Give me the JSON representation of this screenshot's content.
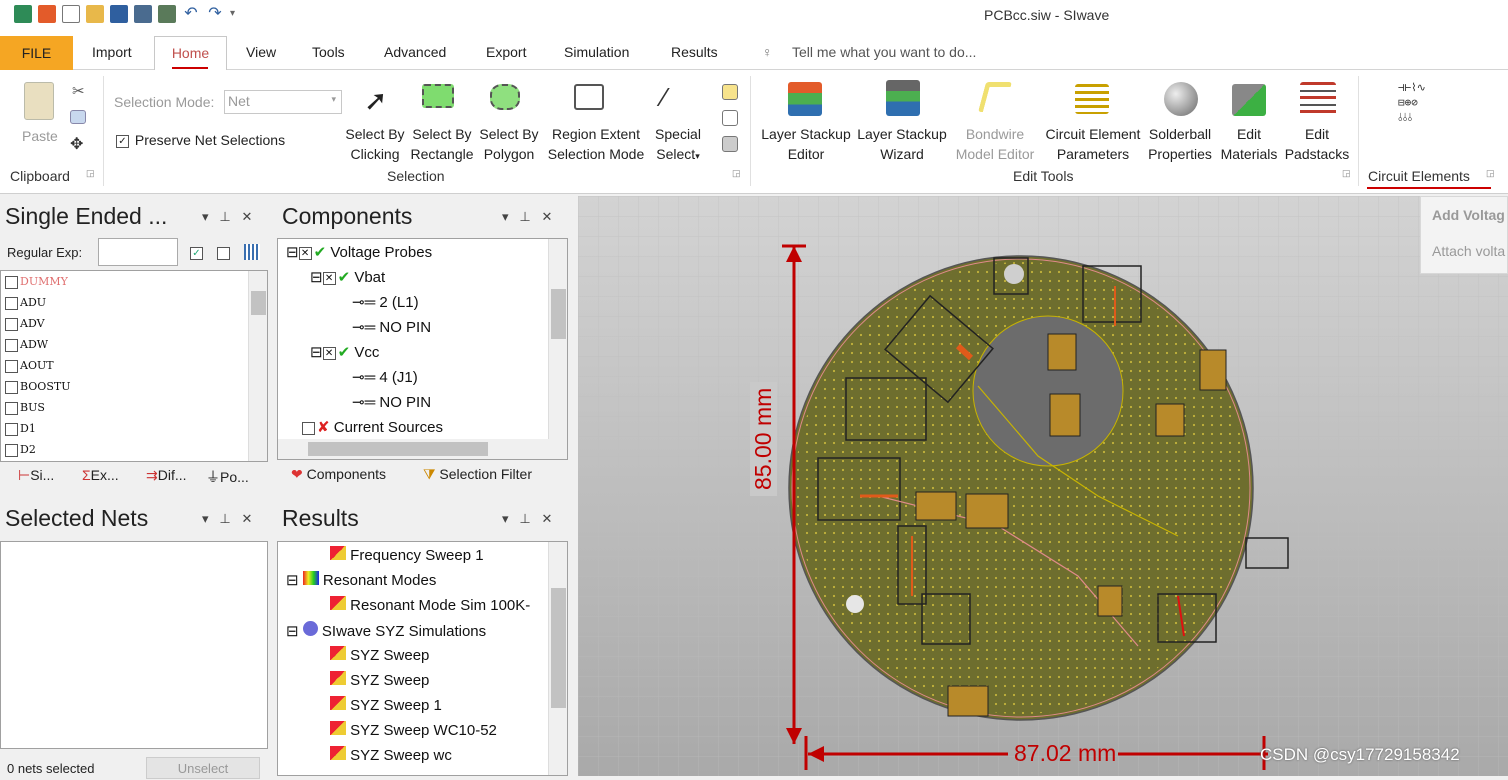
{
  "window": {
    "title": "PCBcc.siw - SIwave"
  },
  "menu": {
    "tabs": [
      "FILE",
      "Import",
      "Home",
      "View",
      "Tools",
      "Advanced",
      "Export",
      "Simulation",
      "Results"
    ],
    "tell_me": "Tell me what you want to do..."
  },
  "ribbon": {
    "clipboard": {
      "paste": "Paste",
      "group": "Clipboard"
    },
    "selection": {
      "mode_label": "Selection Mode:",
      "mode_value": "Net",
      "preserve_label": "Preserve Net Selections",
      "buttons": [
        [
          "Select By",
          "Clicking"
        ],
        [
          "Select By",
          "Rectangle"
        ],
        [
          "Select By",
          "Polygon"
        ],
        [
          "Region Extent",
          "Selection Mode"
        ],
        [
          "Special",
          "Select"
        ]
      ],
      "group": "Selection"
    },
    "edit_tools": {
      "buttons": [
        [
          "Layer Stackup",
          "Editor"
        ],
        [
          "Layer Stackup",
          "Wizard"
        ],
        [
          "Bondwire",
          "Model Editor"
        ],
        [
          "Circuit Element",
          "Parameters"
        ],
        [
          "Solderball",
          "Properties"
        ],
        [
          "Edit",
          "Materials"
        ],
        [
          "Edit",
          "Padstacks"
        ]
      ],
      "group": "Edit Tools"
    },
    "circuit": {
      "group": "Circuit Elements"
    }
  },
  "popup": {
    "items": [
      "Add Voltag",
      "Attach volta"
    ]
  },
  "nets_panel": {
    "title": "Single Ended ...",
    "regexp_label": "Regular Exp:",
    "nets": [
      "DUMMY",
      "ADU",
      "ADV",
      "ADW",
      "AOUT",
      "BOOSTU",
      "BUS",
      "D1",
      "D2"
    ],
    "tabs": [
      "Si...",
      "Ex...",
      "Dif...",
      "Po..."
    ]
  },
  "selected_panel": {
    "title": "Selected Nets",
    "status": "0 nets selected",
    "unselect": "Unselect"
  },
  "components_panel": {
    "title": "Components",
    "tree": [
      "Voltage Probes",
      "Vbat",
      "2 (L1)",
      "NO PIN",
      "Vcc",
      "4 (J1)",
      "NO PIN",
      "Current Sources"
    ],
    "tabs": [
      "Components",
      "Selection Filter"
    ]
  },
  "results_panel": {
    "title": "Results",
    "tree": [
      "Frequency Sweep 1",
      "Resonant Modes",
      "Resonant Mode Sim 100K-",
      "SIwave SYZ Simulations",
      "SYZ Sweep",
      "SYZ Sweep",
      "SYZ Sweep 1",
      "SYZ Sweep WC10-52",
      "SYZ Sweep wc"
    ]
  },
  "canvas": {
    "dim_vertical": "85.00 mm",
    "dim_horizontal": "87.02 mm",
    "watermark": "CSDN @csy17729158342"
  },
  "colors": {
    "accent_file": "#f5a623",
    "dimension": "#c00000",
    "board": "#7a7a2a"
  }
}
